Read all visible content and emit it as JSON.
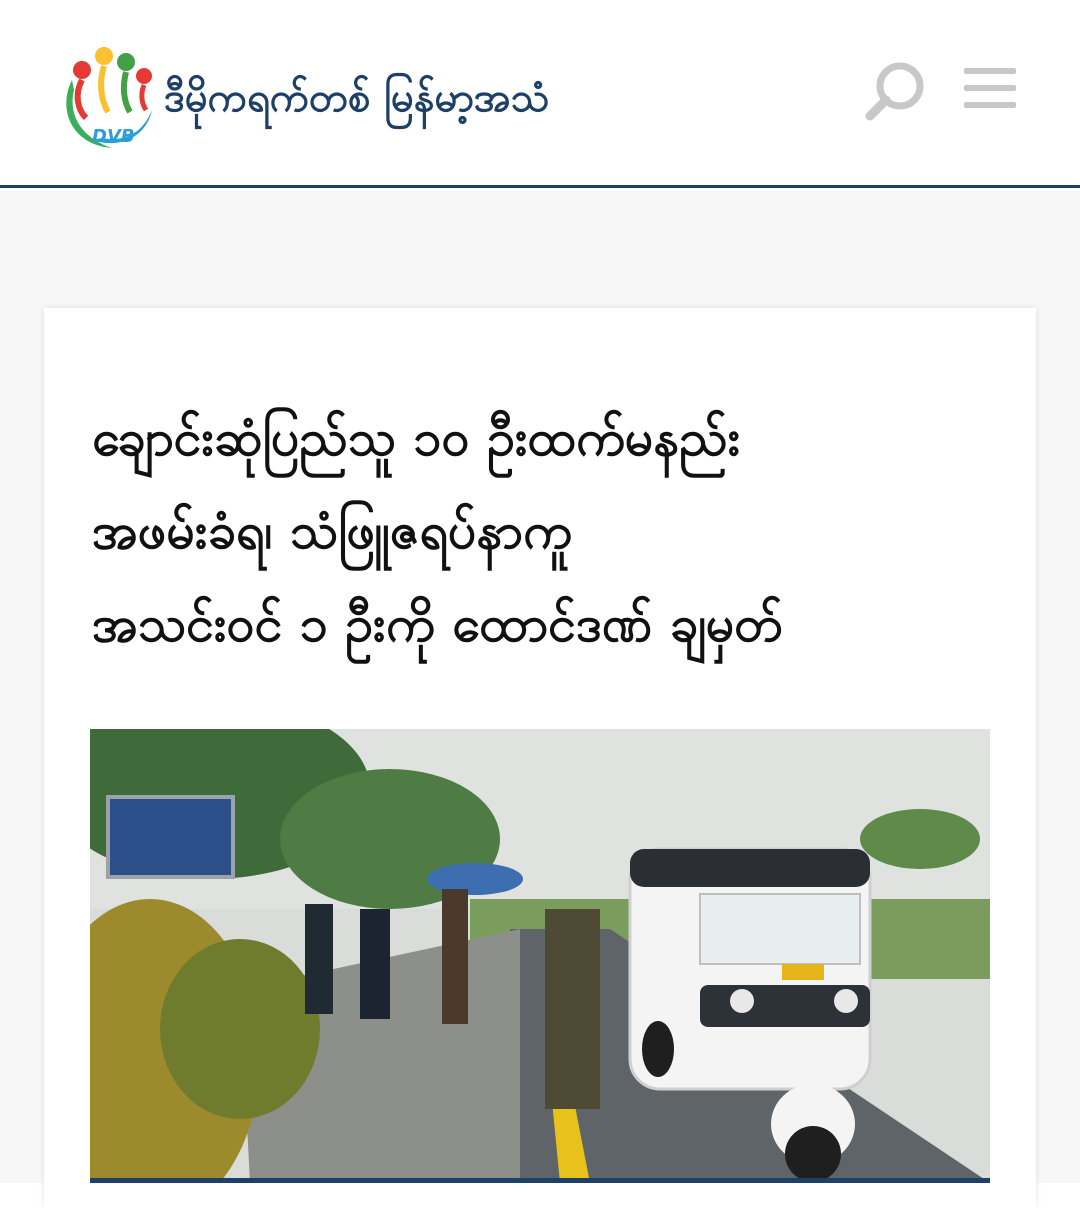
{
  "header": {
    "site_name": "ဒီမိုကရက်တစ် မြန်မာ့အသံ",
    "logo_subtext": "DVB"
  },
  "icons": {
    "search": "search-icon",
    "menu": "hamburger-menu-icon"
  },
  "colors": {
    "brand_navy": "#1e3f66",
    "icon_gray": "#c8c8c8",
    "headline_text": "#111111"
  },
  "article": {
    "headline_lines": [
      "ချောင်းဆုံပြည်သူ ၁၀ ဦးထက်မနည်း",
      "အဖမ်းခံရ၊ သံဖြူဇရပ်နာကူ",
      "အသင်းဝင် ၁ ဦးကို ထောင်ဒဏ် ချမှတ်"
    ],
    "image_alt": "news photo"
  }
}
